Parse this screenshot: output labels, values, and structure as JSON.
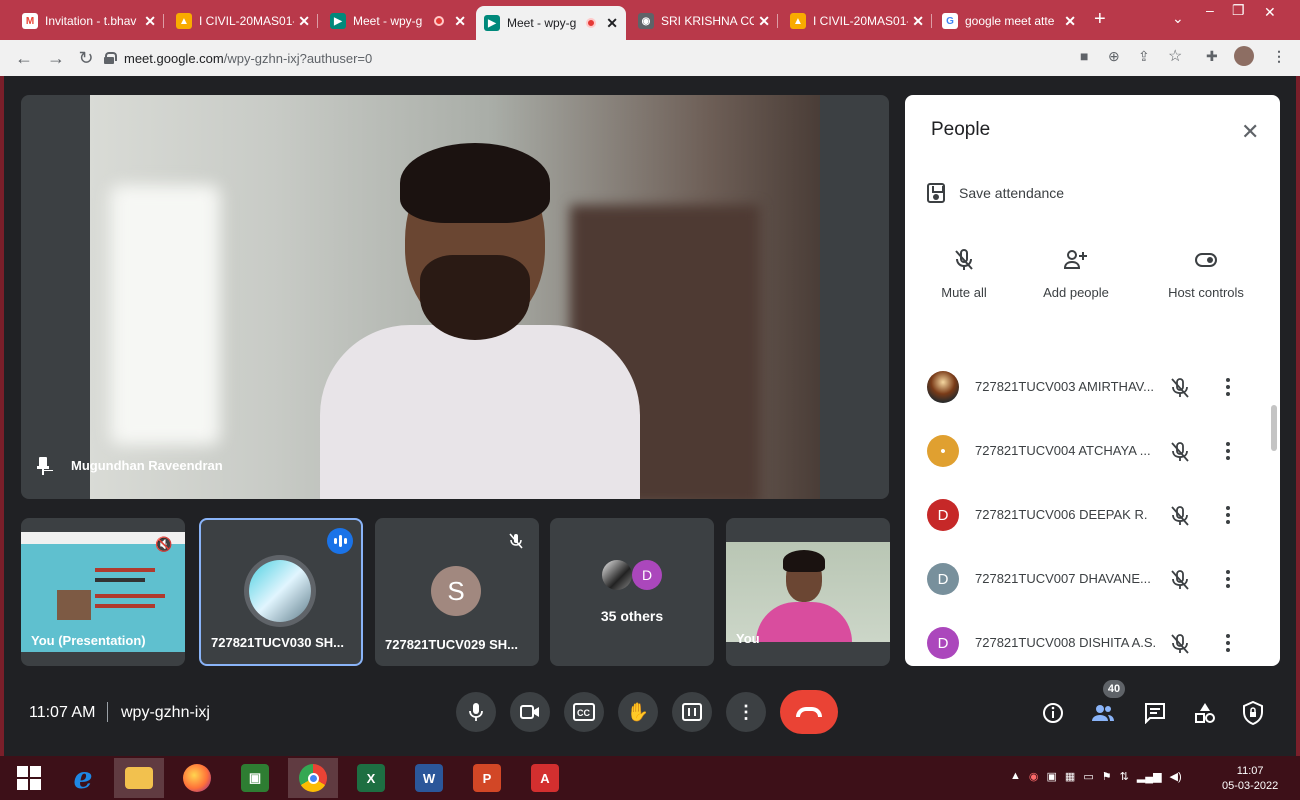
{
  "browser": {
    "tabs": [
      {
        "label": "Invitation - t.bhav",
        "icon": "gmail-icon",
        "color": "#ea4335",
        "recording": false,
        "active": false
      },
      {
        "label": "I CIVIL-20MAS01-",
        "icon": "classroom-icon",
        "color": "#f9ab00",
        "recording": false,
        "active": false
      },
      {
        "label": "Meet - wpy-g",
        "icon": "meet-icon",
        "color": "#00897b",
        "recording": true,
        "active": false
      },
      {
        "label": "Meet - wpy-g",
        "icon": "meet-icon",
        "color": "#00897b",
        "recording": true,
        "active": true
      },
      {
        "label": "SRI KRISHNA COL",
        "icon": "globe-icon",
        "color": "#5f6368",
        "recording": false,
        "active": false
      },
      {
        "label": "I CIVIL-20MAS01-",
        "icon": "classroom-icon",
        "color": "#f9ab00",
        "recording": false,
        "active": false
      },
      {
        "label": "google meet atte",
        "icon": "google-icon",
        "color": "#4285f4",
        "recording": false,
        "active": false
      }
    ],
    "new_tab": "+",
    "url_host": "meet.google.com",
    "url_path": "/wpy-gzhn-ixj?authuser=0"
  },
  "meet": {
    "main_speaker": "Mugundhan Raveendran",
    "tiles": [
      {
        "name": "You (Presentation)"
      },
      {
        "name": "727821TUCV030 SH..."
      },
      {
        "name": "727821TUCV029 SH...",
        "avatar_letter": "S",
        "avatar_color": "#a1887f"
      },
      {
        "name": "35 others",
        "avatar_letter": "D",
        "avatar_color": "#ab47bc"
      },
      {
        "name": "You"
      }
    ]
  },
  "people_panel": {
    "title": "People",
    "close": "✕",
    "save_attendance": "Save attendance",
    "actions": [
      {
        "label": "Mute all",
        "icon": "mic-off-icon"
      },
      {
        "label": "Add people",
        "icon": "add-person-icon"
      },
      {
        "label": "Host controls",
        "icon": "toggle-icon"
      }
    ],
    "participants": [
      {
        "name": "727821TUCV003 AMIRTHAV...",
        "avatar_letter": "",
        "avatar_color": "#6d4c41"
      },
      {
        "name": "727821TUCV004 ATCHAYA ...",
        "avatar_letter": "•",
        "avatar_color": "#e0a030"
      },
      {
        "name": "727821TUCV006 DEEPAK R.",
        "avatar_letter": "D",
        "avatar_color": "#c62828"
      },
      {
        "name": "727821TUCV007 DHAVANE...",
        "avatar_letter": "D",
        "avatar_color": "#78909c"
      },
      {
        "name": "727821TUCV008 DISHITA A.S.",
        "avatar_letter": "D",
        "avatar_color": "#ab47bc"
      }
    ]
  },
  "bottom_bar": {
    "time": "11:07 AM",
    "meeting_code": "wpy-gzhn-ixj",
    "participant_count": "40"
  },
  "taskbar": {
    "clock_time": "11:07",
    "clock_date": "05-03-2022",
    "apps": [
      {
        "icon": "windows-start-icon"
      },
      {
        "icon": "internet-explorer-icon",
        "label": "e",
        "color": "#1e88e5"
      },
      {
        "icon": "file-explorer-icon",
        "label": "",
        "color": "#f2c14e"
      },
      {
        "icon": "firefox-icon",
        "label": "",
        "color": "#ff7139"
      },
      {
        "icon": "store-icon",
        "label": "",
        "color": "#2e7d32"
      },
      {
        "icon": "chrome-icon",
        "label": "",
        "color": "#4285f4"
      },
      {
        "icon": "excel-icon",
        "label": "X",
        "color": "#1d6f42"
      },
      {
        "icon": "word-icon",
        "label": "W",
        "color": "#2b579a"
      },
      {
        "icon": "powerpoint-icon",
        "label": "P",
        "color": "#d24726"
      },
      {
        "icon": "acrobat-icon",
        "label": "A",
        "color": "#d32f2f"
      }
    ]
  }
}
